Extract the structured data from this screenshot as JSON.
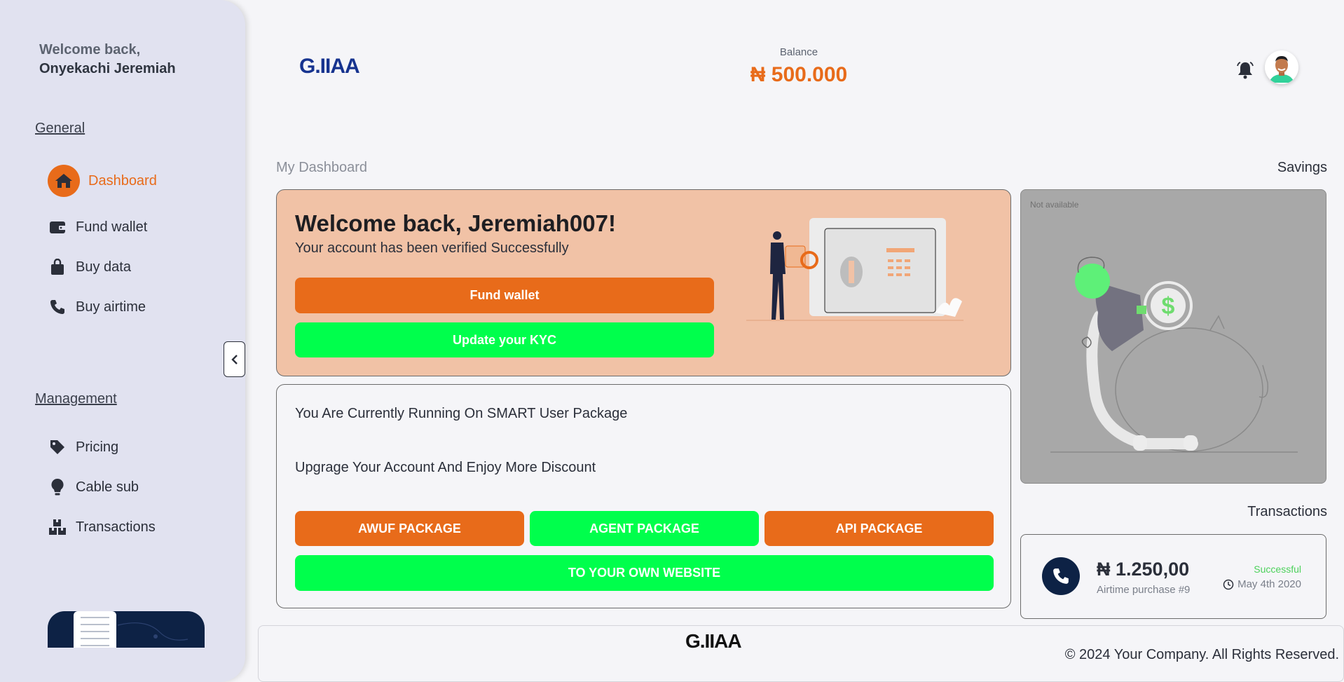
{
  "sidebar": {
    "welcome_line1": "Welcome back,",
    "welcome_line2": "Onyekachi Jeremiah",
    "general_title": "General",
    "general_items": [
      {
        "label": "Dashboard",
        "icon": "home-icon",
        "active": true
      },
      {
        "label": "Fund wallet",
        "icon": "wallet-icon"
      },
      {
        "label": "Buy data",
        "icon": "bag-icon"
      },
      {
        "label": "Buy airtime",
        "icon": "phone-icon"
      }
    ],
    "management_title": "Management",
    "management_items": [
      {
        "label": "Pricing",
        "icon": "tag-icon"
      },
      {
        "label": "Cable sub",
        "icon": "bulb-icon"
      },
      {
        "label": "Transactions",
        "icon": "boxes-icon"
      }
    ],
    "collapse_icon": "chevron-left-icon"
  },
  "header": {
    "logo_text": "G.IIAA",
    "balance_label": "Balance",
    "balance_value": "₦ 500.000",
    "notification_icon": "bell-icon",
    "avatar": "user-avatar"
  },
  "main": {
    "dashboard_title": "My Dashboard",
    "welcome_card": {
      "title": "Welcome back, Jeremiah007!",
      "subtitle": "Your account has been verified Successfully",
      "fund_button": "Fund wallet",
      "kyc_button": "Update your KYC"
    },
    "package_card": {
      "current_package": "You Are Currently Running On SMART User Package",
      "upgrade_text": "Upgrage Your Account And Enjoy More Discount",
      "buttons": [
        "AWUF PACKAGE",
        "AGENT PACKAGE",
        "API PACKAGE"
      ],
      "website_button": "TO YOUR OWN WEBSITE"
    },
    "savings": {
      "title": "Savings",
      "status": "Not available"
    },
    "transactions": {
      "title": "Transactions",
      "item": {
        "amount": "₦ 1.250,00",
        "description": "Airtime purchase #9",
        "status": "Successful",
        "date": "May 4th 2020"
      }
    }
  },
  "footer": {
    "logo_text": "G.IIAA",
    "copyright": "© 2024 Your Company. All Rights Reserved."
  },
  "colors": {
    "accent_orange": "#e86b1a",
    "accent_green": "#00ff4c",
    "navy": "#0d2245",
    "welcome_card_bg": "#f1c2a6",
    "success": "#4cd15b"
  }
}
